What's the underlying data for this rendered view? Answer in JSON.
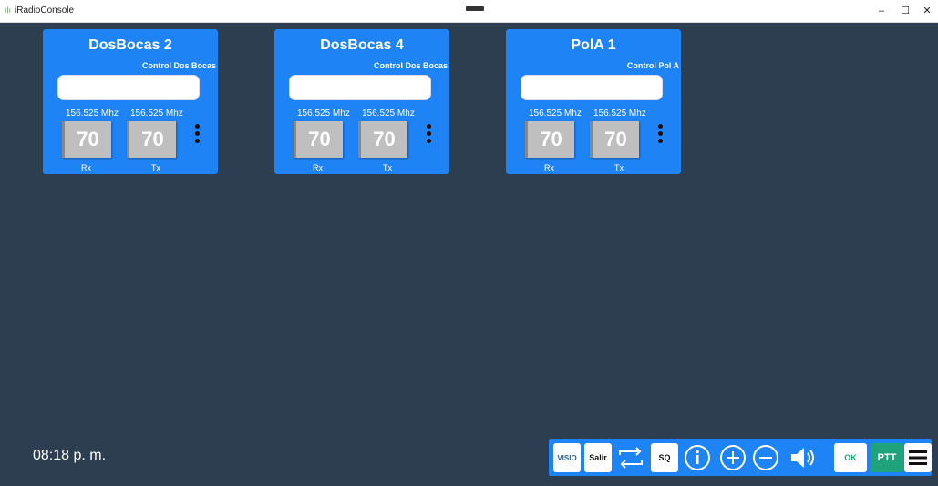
{
  "window": {
    "title": "iRadioConsole",
    "controls": {
      "minimize": "–",
      "maximize": "☐",
      "close": "✕"
    }
  },
  "cards": [
    {
      "title": "DosBocas 2",
      "subtitle": "Control Dos Bocas",
      "input_value": "",
      "rx_freq": "156.525 Mhz",
      "tx_freq": "156.525 Mhz",
      "rx_channel": "70",
      "tx_channel": "70",
      "rx_label": "Rx",
      "tx_label": "Tx"
    },
    {
      "title": "DosBocas 4",
      "subtitle": "Control Dos Bocas",
      "input_value": "",
      "rx_freq": "156.525 Mhz",
      "tx_freq": "156.525 Mhz",
      "rx_channel": "70",
      "tx_channel": "70",
      "rx_label": "Rx",
      "tx_label": "Tx"
    },
    {
      "title": "PolA 1",
      "subtitle": "Control Pol A",
      "input_value": "",
      "rx_freq": "156.525 Mhz",
      "tx_freq": "156.525 Mhz",
      "rx_channel": "70",
      "tx_channel": "70",
      "rx_label": "Rx",
      "tx_label": "Tx"
    }
  ],
  "clock": "08:18 p. m.",
  "toolbar": {
    "visio_label": "VISIO",
    "salir_label": "Salir",
    "sq_label": "SQ",
    "ok_label": "OK",
    "ptt_label": "PTT",
    "icons": [
      "repeat-icon",
      "info-icon",
      "plus-icon",
      "minus-icon",
      "volume-icon",
      "menu-icon"
    ]
  },
  "colors": {
    "background": "#2c3e50",
    "card": "#1e83f5",
    "ptt": "#1fa37a",
    "channel": "#bfbfbf"
  }
}
